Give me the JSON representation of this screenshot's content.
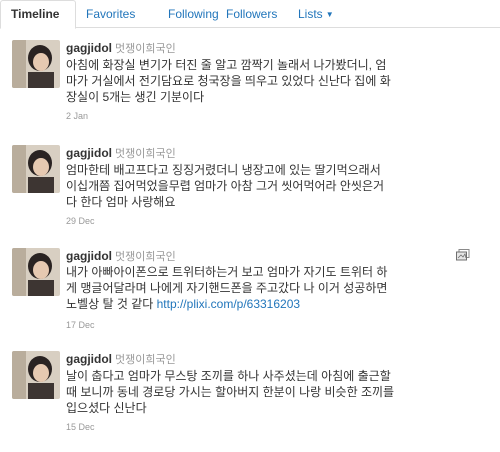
{
  "tabs": [
    "Timeline",
    "Favorites",
    "Following",
    "Followers",
    "Lists"
  ],
  "tweets": [
    {
      "username": "gagjidol",
      "fullname": "멋쟁이희국인",
      "lines": [
        "아침에 화장실 변기가 터진 줄 알고 깜짝기 놀래서 나가봤더니, 엄",
        "마가 거실에서 전기담요로 청국장을 띄우고 있었다 신난다 집에 화",
        "장실이 5개는 생긴 기분이다"
      ],
      "time": "2 Jan"
    },
    {
      "username": "gagjidol",
      "fullname": "멋쟁이희국인",
      "lines": [
        "엄마한테 배고프다고 징징거렸더니 냉장고에 있는 딸기먹으래서",
        "이십개쯤 집어먹었을무렵 엄마가 아참 그거 씻어먹어라 안씻은거",
        "다 한다 엄마 사랑해요"
      ],
      "time": "29 Dec"
    },
    {
      "username": "gagjidol",
      "fullname": "멋쟁이희국인",
      "lines": [
        "내가 아빠아이폰으로 트위터하는거 보고 엄마가 자기도 트위터 하",
        "게 맹글어달라며 나에게 자기핸드폰을 주고갔다 나 이거 성공하면"
      ],
      "line3_text": "노벨상 탈 것 같다 ",
      "link": "http://plixi.com/p/63316203",
      "time": "17 Dec"
    },
    {
      "username": "gagjidol",
      "fullname": "멋쟁이희국인",
      "lines": [
        "날이 춥다고 엄마가 무스탕 조끼를 하나 사주셨는데 아침에 출근할",
        "때 보니까 동네 경로당 가시는 할아버지 한분이 나랑 비슷한 조끼를",
        "입으셨다 신난다"
      ],
      "time": "15 Dec"
    }
  ]
}
